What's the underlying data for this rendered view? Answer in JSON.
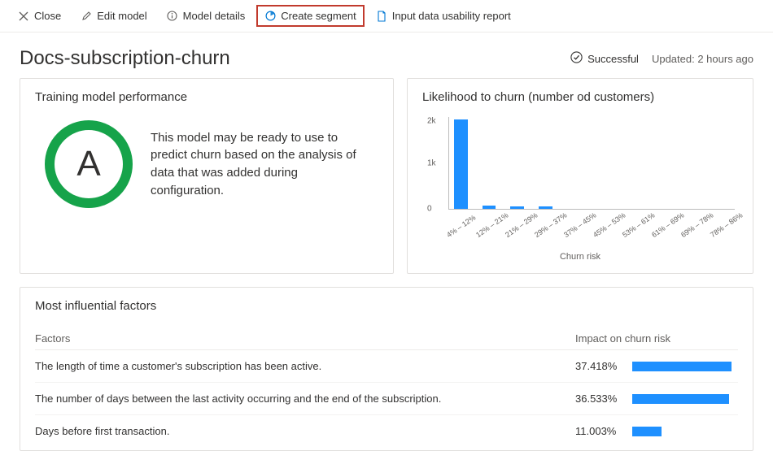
{
  "toolbar": {
    "close": "Close",
    "edit_model": "Edit model",
    "model_details": "Model details",
    "create_segment": "Create segment",
    "usability_report": "Input data usability report"
  },
  "header": {
    "title": "Docs-subscription-churn",
    "status": "Successful",
    "updated": "Updated: 2 hours ago"
  },
  "performance": {
    "title": "Training model performance",
    "grade": "A",
    "description": "This model may be ready to use to predict churn based on the analysis of data that was added during configuration."
  },
  "chart": {
    "title": "Likelihood to churn (number od customers)",
    "x_axis_title": "Churn risk",
    "y_ticks": [
      "2k",
      "1k",
      "0"
    ]
  },
  "chart_data": {
    "type": "bar",
    "categories": [
      "4% – 12%",
      "12% – 21%",
      "21% – 29%",
      "29% – 37%",
      "37% – 45%",
      "45% – 53%",
      "53% – 61%",
      "61% – 69%",
      "69% – 78%",
      "78% – 86%"
    ],
    "values": [
      2050,
      80,
      60,
      60,
      0,
      0,
      0,
      0,
      0,
      0
    ],
    "xlabel": "Churn risk",
    "ylabel": "",
    "ylim": [
      0,
      2100
    ],
    "title": "Likelihood to churn (number od customers)"
  },
  "factors": {
    "title": "Most influential factors",
    "header_factor": "Factors",
    "header_impact": "Impact on churn risk",
    "rows": [
      {
        "text": "The length of time a customer's subscription has been active.",
        "impact": "37.418%",
        "impact_pct": 37.418
      },
      {
        "text": "The number of days between the last activity occurring and the end of the subscription.",
        "impact": "36.533%",
        "impact_pct": 36.533
      },
      {
        "text": "Days before first transaction.",
        "impact": "11.003%",
        "impact_pct": 11.003
      }
    ]
  }
}
